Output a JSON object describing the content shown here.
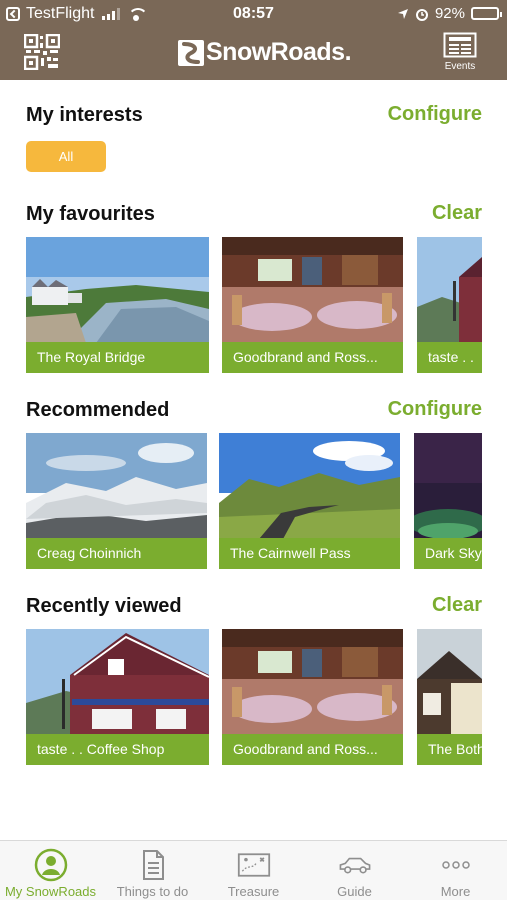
{
  "status_bar": {
    "carrier": "TestFlight",
    "time": "08:57",
    "battery": "92%",
    "battery_level": 0.92
  },
  "header": {
    "logo_text": "SnowRoads.",
    "events_label": "Events",
    "qr_icon": "qr-code-icon",
    "events_icon": "newspaper-icon"
  },
  "sections": {
    "interests": {
      "title": "My interests",
      "action": "Configure",
      "chip": "All"
    },
    "favourites": {
      "title": "My favourites",
      "action": "Clear",
      "cards": [
        "The Royal Bridge",
        "Goodbrand  and  Ross...",
        "taste . ."
      ]
    },
    "recommended": {
      "title": "Recommended",
      "action": "Configure",
      "cards": [
        "Creag Choinnich",
        "The Cairnwell Pass",
        "Dark Sky"
      ]
    },
    "recent": {
      "title": "Recently viewed",
      "action": "Clear",
      "cards": [
        "taste . .  Coffee Shop",
        "Goodbrand  and  Ross...",
        "The Both"
      ]
    }
  },
  "tabs": [
    {
      "label": "My SnowRoads",
      "icon": "person-icon",
      "active": true
    },
    {
      "label": "Things to do",
      "icon": "document-icon",
      "active": false
    },
    {
      "label": "Treasure",
      "icon": "treasure-map-icon",
      "active": false
    },
    {
      "label": "Guide",
      "icon": "car-icon",
      "active": false
    },
    {
      "label": "More",
      "icon": "more-dots-icon",
      "active": false
    }
  ],
  "colors": {
    "header_brown": "#7a6857",
    "accent_green": "#7bad2f",
    "chip_orange": "#f6b83d"
  }
}
